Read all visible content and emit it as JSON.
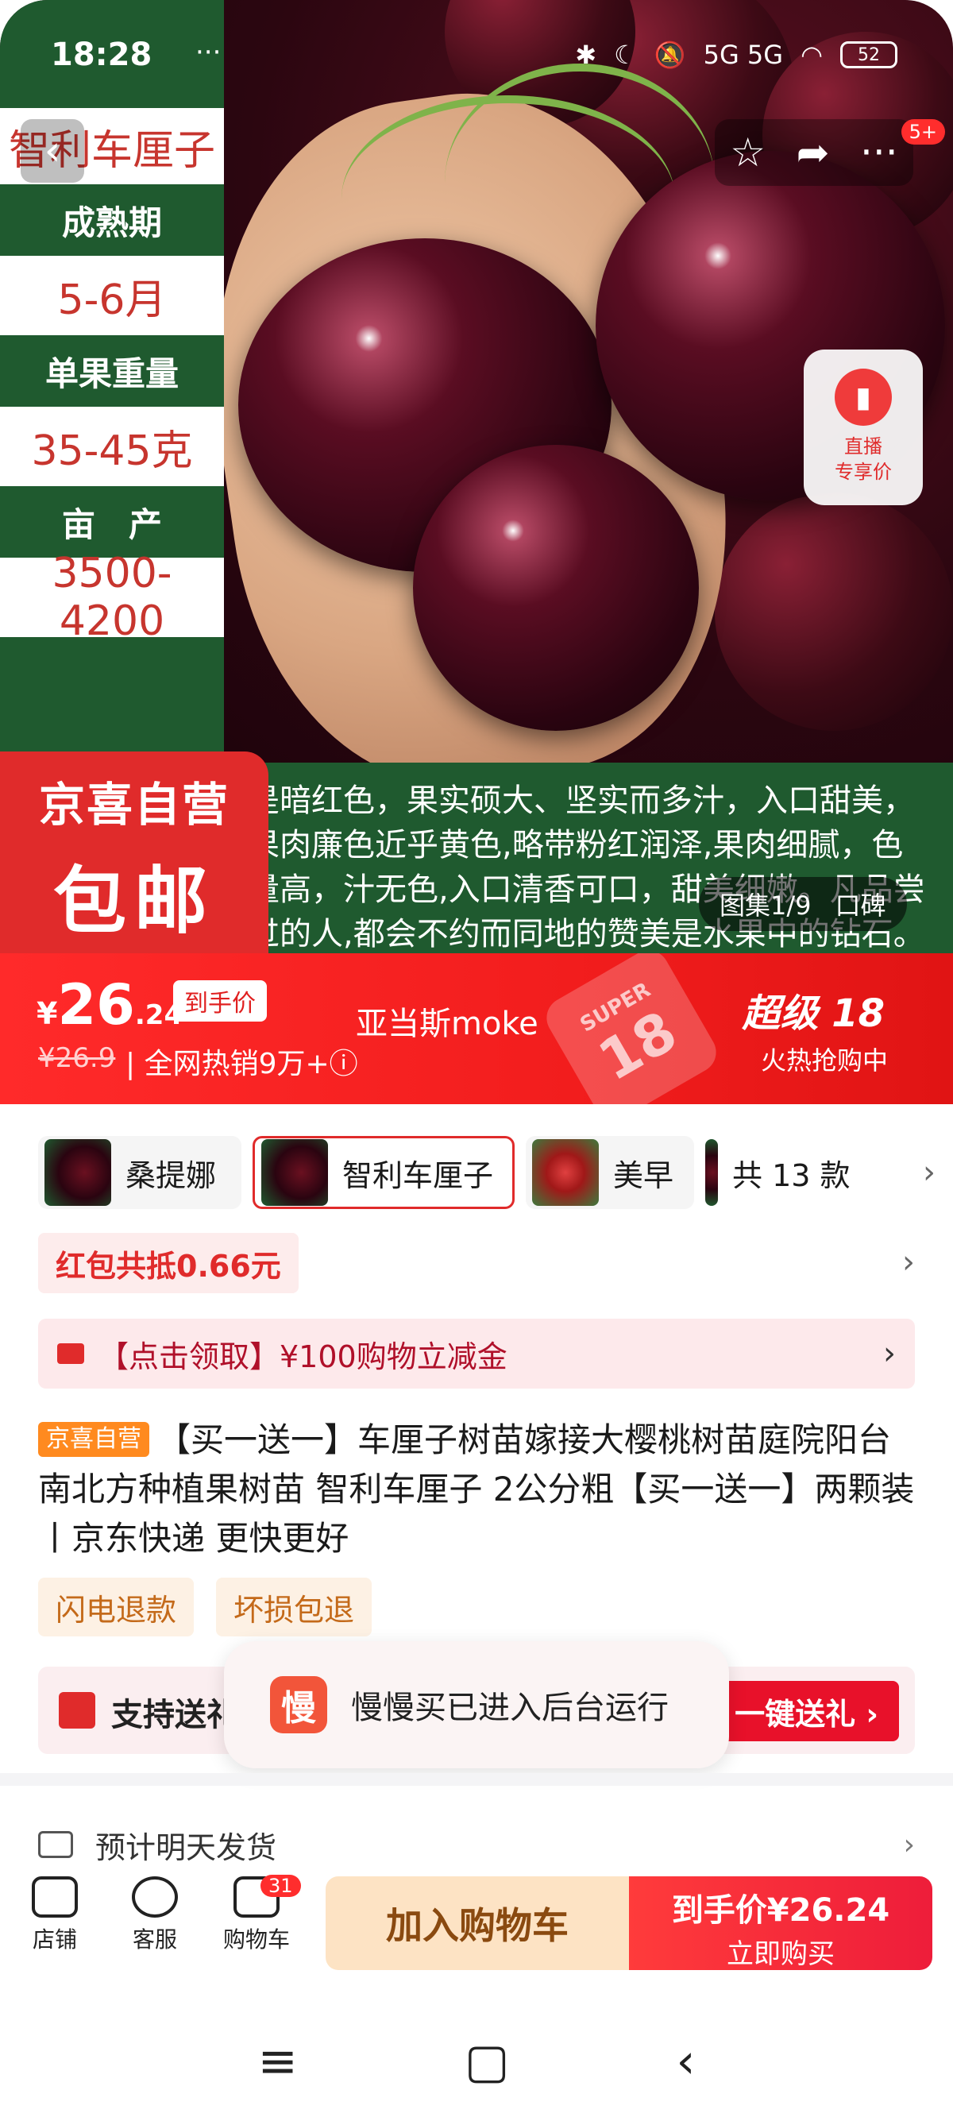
{
  "status_bar": {
    "time": "18:28",
    "extra": "···",
    "network": "5G 5G",
    "battery": "52"
  },
  "hero": {
    "specs": {
      "variety_name": "智利车厘子",
      "ripening_label": "成熟期",
      "ripening_value": "5-6月",
      "weight_label": "单果重量",
      "weight_value": "35-45克",
      "yield_label": "亩　产",
      "yield_value": "3500-4200"
    },
    "desc_lines": [
      "是暗红色，果实硕大、坚实而多汁，入口甜美，",
      "果肉廉色近乎黄色,略带粉红润泽,果肉细腻，色",
      "量高，汁无色,入口清香可口，甜美细嫩。凡品尝",
      "过的人,都会不约而同地的赞美是水果中的钻石。"
    ],
    "jd_badge_line1": "京喜自营",
    "jd_badge_line2": "包邮",
    "gallery_label": "图集1/9",
    "gallery_extra": "口碑",
    "live_label_1": "直播",
    "live_label_2": "专享价",
    "message_badge": "5+"
  },
  "price_banner": {
    "currency": "¥",
    "price_int": "26",
    "price_dec": ".24",
    "price_tag": "到手价",
    "old_price": "¥26.9",
    "sales": "| 全网热销​9万+ⓘ",
    "shop_name": "亚当斯moke",
    "super_title": "超级 18",
    "super_sub": "火热抢购中",
    "deco_1": "SUPER",
    "deco_2": "18"
  },
  "variants": [
    {
      "label": "桑提娜"
    },
    {
      "label": "智利车厘子"
    },
    {
      "label": "美早"
    },
    {
      "label": "共 13 款"
    }
  ],
  "coupon": "红包共抵0.66元",
  "promo": "【点击领取】¥100购物立减金",
  "product": {
    "badge": "京喜自营",
    "title": "【买一送一】车厘子树苗嫁接大樱桃树苗庭院阳台南北方种植果树苗 智利车厘子 2公分粗【买一送一】两颗装丨京东快递 更快更好"
  },
  "service_tags": [
    "闪电退款",
    "坏损包退"
  ],
  "gift": {
    "text": "支持送礼",
    "button": "一键送礼 ›"
  },
  "toast": {
    "icon": "慢",
    "text": "慢慢买已进入后台运行"
  },
  "shipping": "预计明天发货",
  "action_bar": {
    "shop": "店铺",
    "service": "客服",
    "cart": "购物车",
    "cart_count": "31",
    "add_cart": "加入购物车",
    "buy_price": "到手价¥26.24",
    "buy_now": "立即购买"
  },
  "nav": {
    "menu": "≡",
    "home": "▢",
    "back": "‹"
  }
}
